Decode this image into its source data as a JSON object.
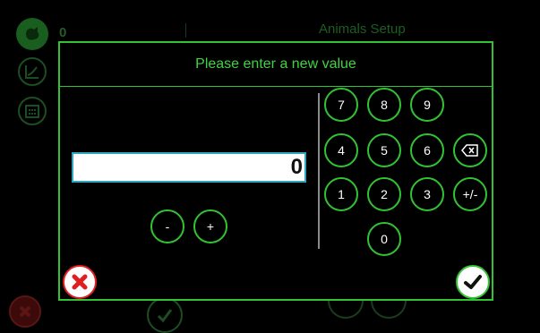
{
  "background": {
    "title": "Animals Setup",
    "value": "0",
    "sidebar_icons": [
      "app-logo-icon",
      "chart-icon",
      "calendar-icon"
    ]
  },
  "dialog": {
    "title": "Please enter a new value",
    "value": "0",
    "decrement_label": "-",
    "increment_label": "+",
    "keypad": {
      "row1": [
        "7",
        "8",
        "9"
      ],
      "row2": [
        "4",
        "5",
        "6"
      ],
      "row3": [
        "1",
        "2",
        "3",
        "+/-"
      ],
      "row4": [
        "0"
      ]
    },
    "backspace_icon": "backspace-icon",
    "cancel_icon": "close-icon",
    "confirm_icon": "checkmark-icon"
  },
  "colors": {
    "accent": "#32c332",
    "title_text": "#3fd43f",
    "input_border": "#2fa6bd",
    "cancel": "#e02020",
    "background": "#000000"
  }
}
